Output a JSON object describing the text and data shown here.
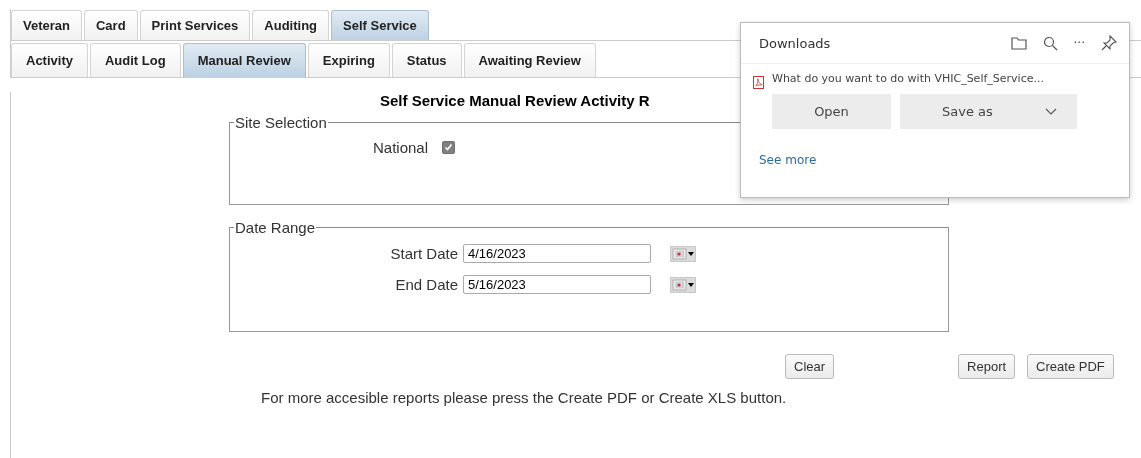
{
  "tabs": [
    {
      "label": "Veteran",
      "selected": false
    },
    {
      "label": "Card",
      "selected": false
    },
    {
      "label": "Print Services",
      "selected": false
    },
    {
      "label": "Auditing",
      "selected": false
    },
    {
      "label": "Self Service",
      "selected": true
    }
  ],
  "subtabs": [
    {
      "label": "Activity",
      "selected": false
    },
    {
      "label": "Audit Log",
      "selected": false
    },
    {
      "label": "Manual Review",
      "selected": true
    },
    {
      "label": "Expiring",
      "selected": false
    },
    {
      "label": "Status",
      "selected": false
    },
    {
      "label": "Awaiting Review",
      "selected": false
    }
  ],
  "title": "Self Service Manual Review Activity R",
  "site_selection": {
    "legend": "Site Selection",
    "label": "National",
    "checked": true
  },
  "date_range": {
    "legend": "Date Range",
    "fields": [
      {
        "label": "Start Date",
        "value": "4/16/2023"
      },
      {
        "label": "End Date",
        "value": "5/16/2023"
      }
    ]
  },
  "buttons": {
    "clear": "Clear",
    "actions": [
      "Report",
      "Create PDF"
    ]
  },
  "note": "For more accesible reports please press the Create PDF or Create XLS button.",
  "downloads": {
    "title": "Downloads",
    "message": "What do you want to do with VHIC_Self_Service...",
    "open": "Open",
    "save": "Save as",
    "more_symbol": "···",
    "link": "See more"
  }
}
